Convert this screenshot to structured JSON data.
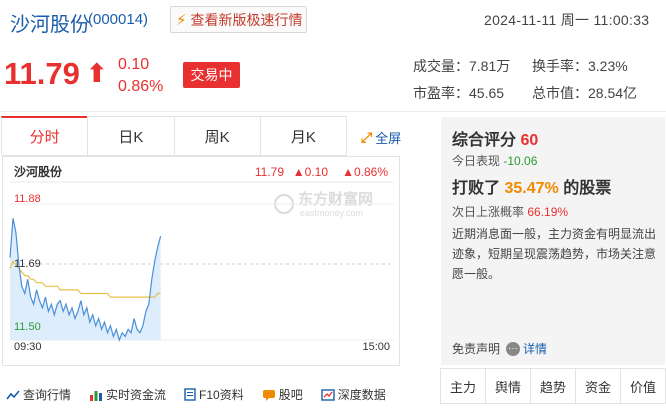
{
  "header": {
    "name": "沙河股份",
    "code": "(000014)",
    "quote_button": "查看新版极速行情",
    "datetime": "2024-11-11 周一 11:00:33"
  },
  "quote": {
    "price": "11.79",
    "arrow": "⬆",
    "change": "0.10",
    "change_pct": "0.86%",
    "status": "交易中"
  },
  "stats": {
    "volume_label": "成交量：",
    "volume": "7.81万",
    "turnover_label": "换手率：",
    "turnover": "3.23%",
    "pe_label": "市盈率：",
    "pe": "45.65",
    "mcap_label": "总市值：",
    "mcap": "28.54亿"
  },
  "tabs": [
    "分时",
    "日K",
    "周K",
    "月K"
  ],
  "fullscreen": "全屏",
  "chart": {
    "name": "沙河股份",
    "price": "11.79",
    "change": "▲0.10",
    "change_pct": "▲0.86%",
    "high_label": "11.88",
    "mid_label": "11.69",
    "low_label": "11.50",
    "start_time": "09:30",
    "end_time": "15:00",
    "watermark_cn": "东方财富网",
    "watermark_en": "eastmoney.com"
  },
  "chart_data": {
    "type": "line",
    "ylim": [
      11.5,
      11.88
    ],
    "reference": 11.69,
    "series": [
      {
        "values": [
          11.73,
          11.84,
          11.8,
          11.71,
          11.65,
          11.63,
          11.67,
          11.62,
          11.6,
          11.64,
          11.61,
          11.59,
          11.62,
          11.58,
          11.6,
          11.57,
          11.6,
          11.61,
          11.58,
          11.6,
          11.57,
          11.59,
          11.56,
          11.58,
          11.61,
          11.57,
          11.59,
          11.55,
          11.57,
          11.54,
          11.56,
          11.53,
          11.55,
          11.52,
          11.54,
          11.51,
          11.53,
          11.5,
          11.52,
          11.51,
          11.53,
          11.52,
          11.56,
          11.53,
          11.52,
          11.54,
          11.58,
          11.6,
          11.67,
          11.72,
          11.76,
          11.79
        ]
      },
      {
        "values": [
          11.7,
          11.72,
          11.71,
          11.7,
          11.69,
          11.68,
          11.68,
          11.67,
          11.67,
          11.66,
          11.66,
          11.66,
          11.65,
          11.65,
          11.65,
          11.65,
          11.65,
          11.64,
          11.64,
          11.64,
          11.64,
          11.64,
          11.64,
          11.64,
          11.63,
          11.63,
          11.63,
          11.63,
          11.63,
          11.63,
          11.63,
          11.63,
          11.63,
          11.63,
          11.62,
          11.62,
          11.62,
          11.62,
          11.62,
          11.62,
          11.62,
          11.62,
          11.62,
          11.62,
          11.62,
          11.62,
          11.62,
          11.62,
          11.62,
          11.62,
          11.63,
          11.63
        ]
      }
    ],
    "colors": {
      "price_line": "#4a8fd8",
      "avg_line": "#e8c24a",
      "fill": "#d5e8fb"
    }
  },
  "panel": {
    "title": "综合评分",
    "score": "60",
    "today_label": "今日表现",
    "today_value": "-10.06",
    "beat_prefix": "打败了",
    "beat_pct": "35.47%",
    "beat_suffix": "的股票",
    "nextday_label": "次日上涨概率",
    "nextday_value": "66.19%",
    "description": "近期消息面一般，主力资金有明显流出迹象，短期呈现震荡趋势，市场关注意愿一般。",
    "disclaimer": "免责声明",
    "detail": "详情"
  },
  "right_tabs": [
    "主力",
    "舆情",
    "趋势",
    "资金",
    "价值"
  ],
  "bottom_links": [
    {
      "label": "查询行情",
      "icon": "chart-line-icon"
    },
    {
      "label": "实时资金流",
      "icon": "bar-chart-icon"
    },
    {
      "label": "F10资料",
      "icon": "document-icon"
    },
    {
      "label": "股吧",
      "icon": "forum-icon"
    },
    {
      "label": "深度数据",
      "icon": "data-icon"
    }
  ],
  "colors": {
    "up": "#e93030",
    "down": "#2a9a35",
    "link": "#1a5dab",
    "accent": "#f08a00"
  }
}
